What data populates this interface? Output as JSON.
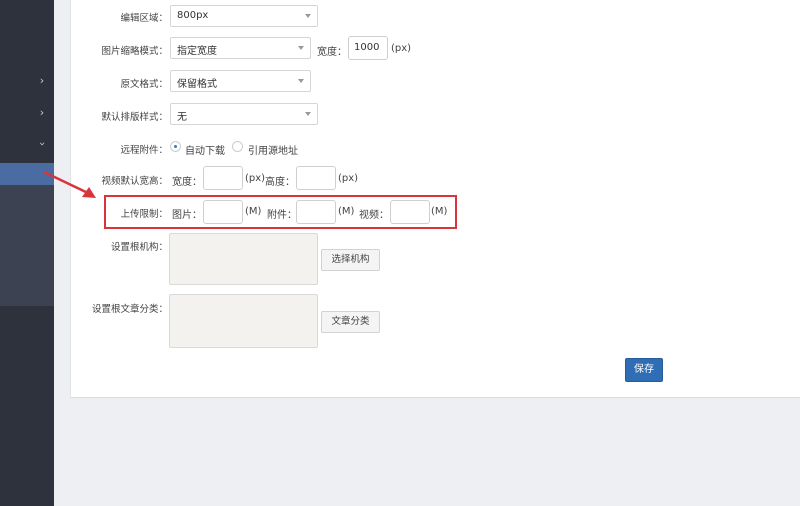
{
  "form": {
    "edit_area": {
      "label": "编辑区域：",
      "value": "800px"
    },
    "thumb_mode": {
      "label": "图片缩略模式：",
      "value": "指定宽度",
      "width_label": "宽度：",
      "width_value": "1000",
      "unit": "(px)"
    },
    "format": {
      "label": "原文格式：",
      "value": "保留格式"
    },
    "layout_style": {
      "label": "默认排版样式：",
      "value": "无"
    },
    "remote_attachment": {
      "label": "远程附件：",
      "option1": "自动下载",
      "option2": "引用源地址",
      "selected": "option1"
    },
    "video_size": {
      "label": "视频默认宽高：",
      "width_label": "宽度：",
      "width_value": "",
      "unit1": "(px)",
      "height_label": "高度：",
      "height_value": "",
      "unit2": "(px)"
    },
    "upload_limit": {
      "label": "上传限制：",
      "image_label": "图片：",
      "image_value": "",
      "image_unit": "(M)",
      "attach_label": "附件：",
      "attach_value": "",
      "attach_unit": "(M)",
      "video_label": "视频：",
      "video_value": "",
      "video_unit": "(M)"
    },
    "root_org": {
      "label": "设置根机构：",
      "button": "选择机构"
    },
    "root_category": {
      "label": "设置根文章分类：",
      "button": "文章分类"
    },
    "save_button": "保存"
  },
  "sidebar": {
    "chevrons": [
      "chevron-right",
      "chevron-right",
      "chevron-down"
    ]
  },
  "colors": {
    "sidebar": "#2e323d",
    "sidebar_active": "#4b6ca3",
    "save_button": "#2f6eb5",
    "highlight": "#d9343a"
  }
}
